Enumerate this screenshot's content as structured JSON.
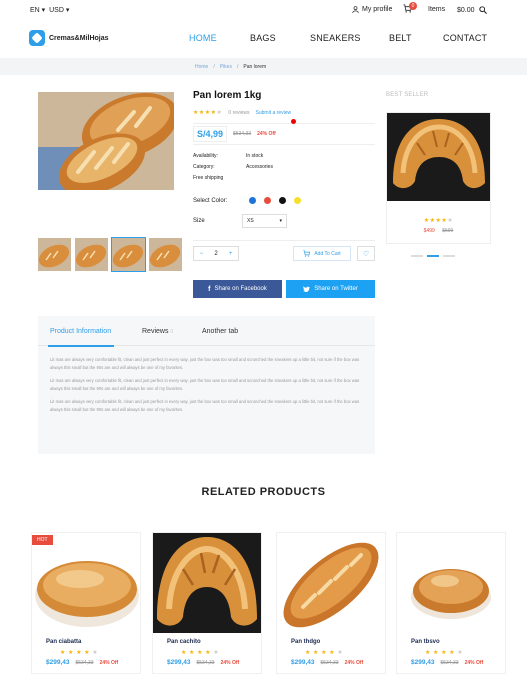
{
  "topbar": {
    "language": "EN",
    "currency": "USD",
    "profile": "My profile",
    "cart_count": "0",
    "items": "Items",
    "total": "$0.00"
  },
  "nav": {
    "logo": "Cremas&MilHojas",
    "menu": [
      "HOME",
      "BAGS",
      "SNEAKERS",
      "BELT",
      "CONTACT"
    ],
    "active": "HOME"
  },
  "breadcrumb": [
    "Home",
    "Pikes",
    "Pan lorem"
  ],
  "product": {
    "title": "Pan lorem 1kg",
    "reviews": "0 reviews",
    "submit_review": "Submit a review",
    "price": "S/4,99",
    "old_price": "$534,33",
    "discount": "24% Off",
    "specs": [
      {
        "k": "Availability:",
        "v": "In stock"
      },
      {
        "k": "Category:",
        "v": "Accessories"
      },
      {
        "k": "Free shipping",
        "v": ""
      }
    ],
    "select_color_label": "Select Color:",
    "colors": [
      "#1e73d8",
      "#e74c3c",
      "#111111",
      "#f7e02a"
    ],
    "size_label": "Size",
    "size_value": "XS",
    "qty": "2",
    "add_to_cart": "Add To Cart",
    "share_facebook": "Share on Facebook",
    "share_twitter": "Share on Twitter"
  },
  "sidebar": {
    "heading": "BEST SELLER",
    "price_new": "$499",
    "price_old": "$599"
  },
  "tabs": {
    "labels": [
      "Product Information",
      "Reviews",
      "Another tab"
    ],
    "reviews_count": "0",
    "paragraphs": [
      "Lit mas are always very comfortable fit, clean and just perfect in every way. just the box was too small and scrunched the sneakers up a little bit, not sure if the box was always this small but the 90s are and will always be one of my favorites.",
      "Lit mas are always very comfortable fit, clean and just perfect in every way. just the box was too small and scrunched the sneakers up a little bit, not sure if the box was always this small but the 90s are and will always be one of my favorites.",
      "Lit mas are always very comfortable fit, clean and just perfect in every way. just the box was too small and scrunched the sneakers up a little bit, not sure if the box was always this small but the 90s are and will always be one of my favorites."
    ]
  },
  "related": {
    "title": "RELATED PRODUCTS",
    "hot_label": "HOT",
    "products": [
      {
        "name": "Pan ciabatta",
        "price": "$299,43",
        "old": "$534,33",
        "off": "24% Off"
      },
      {
        "name": "Pan cachito",
        "price": "$299,43",
        "old": "$534,33",
        "off": "24% Off"
      },
      {
        "name": "Pan thdgo",
        "price": "$299,43",
        "old": "$534,33",
        "off": "24% Off"
      },
      {
        "name": "Pan tbsvo",
        "price": "$299,43",
        "old": "$534,33",
        "off": "24% Off"
      }
    ]
  },
  "rating": {
    "filled": 4,
    "total": 5
  }
}
